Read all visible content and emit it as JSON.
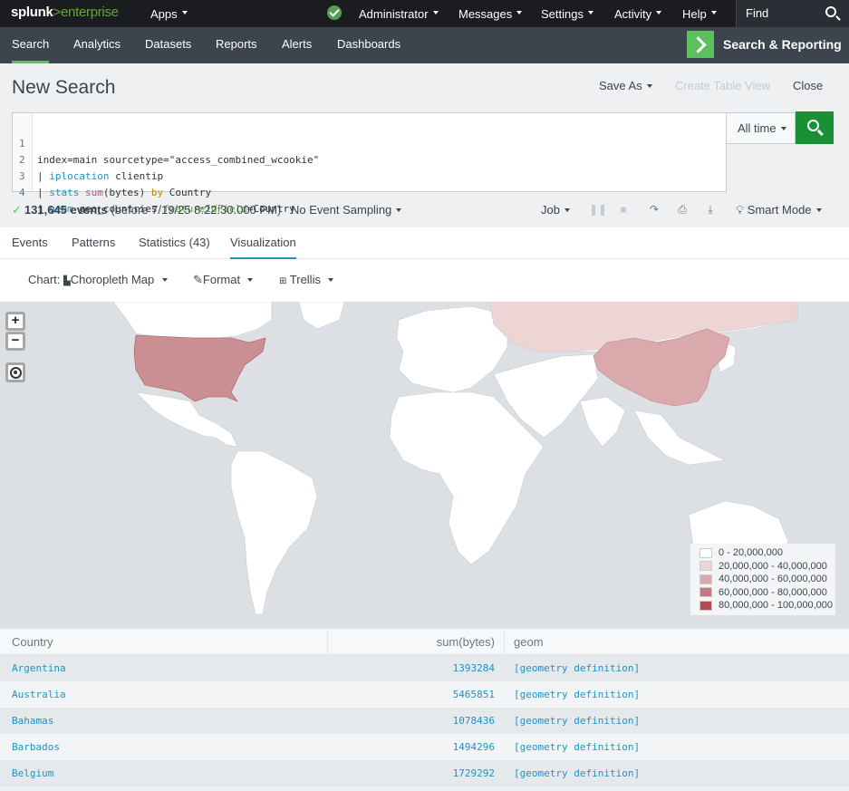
{
  "brand": {
    "part1": "splunk",
    "part2": ">enterprise"
  },
  "topnav": {
    "apps": "Apps",
    "administrator": "Administrator",
    "messages": "Messages",
    "settings": "Settings",
    "activity": "Activity",
    "help": "Help",
    "find": "Find"
  },
  "appbar": {
    "tabs": [
      "Search",
      "Analytics",
      "Datasets",
      "Reports",
      "Alerts",
      "Dashboards"
    ],
    "app_name": "Search & Reporting"
  },
  "header": {
    "title": "New Search",
    "save_as": "Save As",
    "create_table_view": "Create Table View",
    "close": "Close"
  },
  "editor": {
    "line_numbers": [
      "1",
      "2",
      "3",
      "4"
    ],
    "l1": "index=main sourcetype=\"access_combined_wcookie\"",
    "l2_pipe": "| ",
    "l2_cmd": "iplocation",
    "l2_rest": " clientip",
    "l3_pipe": "| ",
    "l3_cmd": "stats",
    "l3_sp": " ",
    "l3_fn": "sum",
    "l3_args": "(bytes) ",
    "l3_by": "by",
    "l3_rest": " Country",
    "l4_pipe": "| ",
    "l4_cmd": "geom",
    "l4_mid": " geo_countries ",
    "l4_arg": "featureIdField",
    "l4_rest": "=Country"
  },
  "time_picker": "All time",
  "status": {
    "events": "131,645 events",
    "before": "(before 7/19/25 8:22:30.000 PM)",
    "sampling": "No Event Sampling",
    "job": "Job",
    "mode": "Smart Mode"
  },
  "result_tabs": [
    "Events",
    "Patterns",
    "Statistics (43)",
    "Visualization"
  ],
  "viz_toolbar": {
    "chart_prefix": "Chart:",
    "chart_type": "Choropleth Map",
    "format": "Format",
    "trellis": "Trellis"
  },
  "map": {
    "zoom_in": "+",
    "zoom_out": "−",
    "legend": [
      {
        "label": "0 - 20,000,000",
        "color": "#ffffff"
      },
      {
        "label": "20,000,000 - 40,000,000",
        "color": "#edd5d6"
      },
      {
        "label": "40,000,000 - 60,000,000",
        "color": "#d9a9ab"
      },
      {
        "label": "60,000,000 - 80,000,000",
        "color": "#c47a7e"
      },
      {
        "label": "80,000,000 - 100,000,000",
        "color": "#b04c52"
      }
    ]
  },
  "table": {
    "headers": [
      "Country",
      "sum(bytes)",
      "geom"
    ],
    "rows": [
      {
        "country": "Argentina",
        "bytes": "1393284",
        "geom": "[geometry definition]"
      },
      {
        "country": "Australia",
        "bytes": "5465851",
        "geom": "[geometry definition]"
      },
      {
        "country": "Bahamas",
        "bytes": "1078436",
        "geom": "[geometry definition]"
      },
      {
        "country": "Barbados",
        "bytes": "1494296",
        "geom": "[geometry definition]"
      },
      {
        "country": "Belgium",
        "bytes": "1729292",
        "geom": "[geometry definition]"
      }
    ]
  },
  "colors": {
    "topbar": "#1a1c20",
    "appbar": "#3c444d",
    "accent_green": "#5cc05c",
    "search_button": "#1a9035",
    "link_blue": "#1e93c6"
  }
}
